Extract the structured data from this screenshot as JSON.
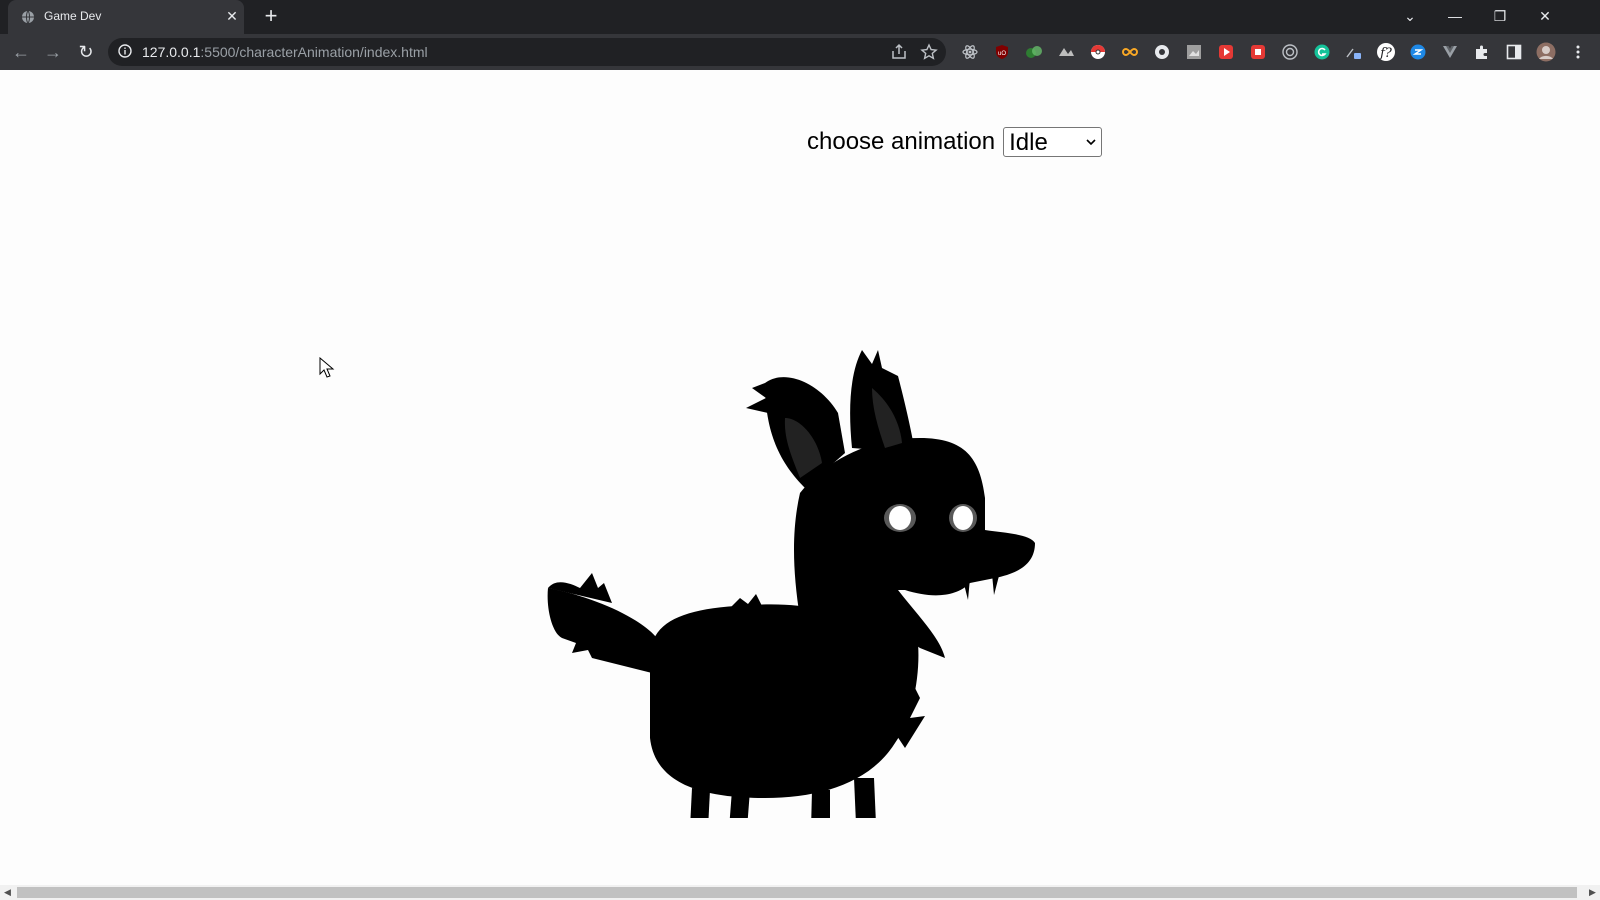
{
  "browser": {
    "tab_title": "Game Dev",
    "tab_close_glyph": "✕",
    "new_tab_glyph": "+",
    "url_host": "127.0.0.1",
    "url_rest": ":5500/characterAnimation/index.html",
    "window_controls": [
      "⌄",
      "—",
      "❐",
      "✕"
    ],
    "nav": {
      "back": "←",
      "forward": "→",
      "reload": "↻"
    },
    "extensions": [
      "react-devtools-icon",
      "ublock-icon",
      "color-picker-icon",
      "sketch-icon",
      "pokeball-icon",
      "infinity-icon",
      "circle-ext-icon",
      "image-ext-icon",
      "red-play-icon",
      "red-square-icon",
      "target-icon",
      "grammarly-icon",
      "wand-ext-icon",
      "font-ninja-icon",
      "blue-ext-icon",
      "vue-devtools-icon",
      "puzzle-icon",
      "sidepanel-icon",
      "profile-avatar",
      "menu-kebab-icon"
    ]
  },
  "page": {
    "control_label": "choose animation",
    "select": {
      "selected": "Idle"
    }
  },
  "colors": {
    "page_bg": "#fdfdfd",
    "sprite": "#000000",
    "eyes": "#ffffff",
    "chrome_dark": "#202124",
    "chrome_mid": "#35363a"
  }
}
